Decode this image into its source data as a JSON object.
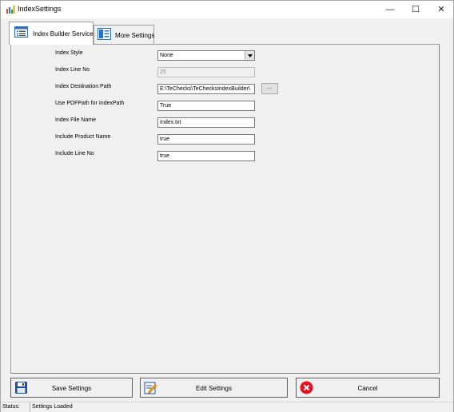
{
  "window": {
    "title": "IndexSettings",
    "minimize": "—",
    "maximize": "☐",
    "close": "✕"
  },
  "tabs": [
    {
      "label": "Index Builder Service",
      "icon": "list-icon",
      "active": true
    },
    {
      "label": "More Settings",
      "icon": "settings-icon",
      "active": false
    }
  ],
  "form": {
    "index_style": {
      "label": "Index Style",
      "value": "None"
    },
    "index_line_no": {
      "label": "Index Line No",
      "value": "25"
    },
    "index_destination_path": {
      "label": "Index Destination Path",
      "value": "E:\\TeChecks\\TeChecksIndexBuilder\\",
      "browse": "..."
    },
    "use_pdfpath": {
      "label": "Use PDFPath for IndexPath",
      "value": "True"
    },
    "index_file_name": {
      "label": "Index File Name",
      "value": "Index.txt"
    },
    "include_product_name": {
      "label": "Include Product Name",
      "value": "true"
    },
    "include_line_no": {
      "label": "Include Line No",
      "value": "true"
    }
  },
  "buttons": {
    "save": "Save Settings",
    "edit": "Edit Settings",
    "cancel": "Cancel"
  },
  "status": {
    "label": "Status:",
    "value": "Settings Loaded"
  },
  "colors": {
    "cancel_red": "#e81123",
    "save_blue": "#1e4fa3",
    "tab_icon_blue": "#2a6fc9"
  }
}
